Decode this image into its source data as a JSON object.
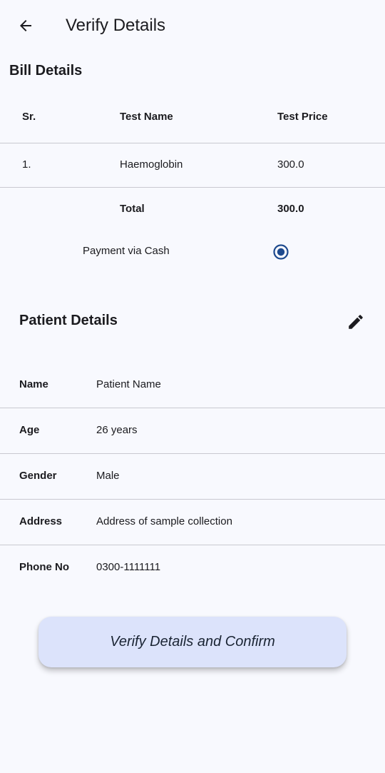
{
  "app_bar": {
    "back_icon": "arrow-back-icon",
    "title": "Verify Details"
  },
  "bill": {
    "title": "Bill Details",
    "headers": [
      "Sr.",
      "Test Name",
      "Test Price"
    ],
    "rows": [
      {
        "sr": "1.",
        "name": "Haemoglobin",
        "price": "300.0"
      }
    ],
    "total_label": "Total",
    "total_value": "300.0"
  },
  "payment": {
    "label": "Payment via Cash",
    "selected": true,
    "accent_color": "#1e4a8e"
  },
  "patient": {
    "title": "Patient Details",
    "edit_icon": "edit-pencil-icon",
    "fields": [
      {
        "label": "Name",
        "value": "Patient Name"
      },
      {
        "label": "Age",
        "value": "26 years"
      },
      {
        "label": "Gender",
        "value": "Male"
      },
      {
        "label": "Address",
        "value": "Address of sample collection"
      },
      {
        "label": "Phone No",
        "value": "0300-1111111"
      }
    ]
  },
  "confirm_button": {
    "label": "Verify Details and Confirm",
    "background": "#dce3fb"
  }
}
